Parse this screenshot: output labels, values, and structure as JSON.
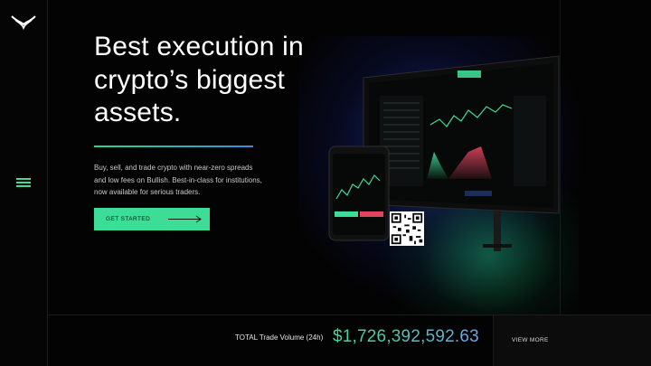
{
  "brand": {
    "logo_icon": "bull-horns-logo"
  },
  "nav": {
    "menu_icon": "hamburger-menu-icon",
    "accent": "#3ddc97"
  },
  "hero": {
    "title": "Best execution in\ncrypto’s biggest\nassets.",
    "description": "Buy, sell, and trade crypto with near-zero spreads and low fees on Bullish. Best-in-class for institutions, now available for serious traders.",
    "cta_label": "GET STARTED",
    "cta_icon": "arrow-right-icon"
  },
  "colors": {
    "background": "#030303",
    "accent_green": "#3ddc97",
    "accent_blue": "#3a8ed8"
  },
  "footer": {
    "volume_label": "TOTAL Trade Volume (24h)",
    "volume_value": "$1,726,392,592.63",
    "view_more_label": "VIEW MORE"
  }
}
